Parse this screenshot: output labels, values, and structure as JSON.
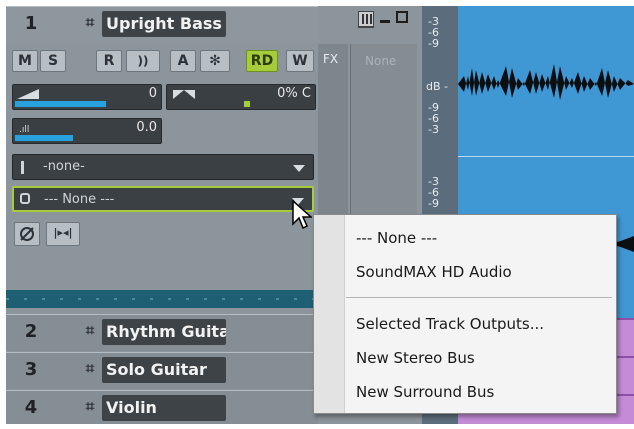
{
  "tracks": [
    {
      "number": "1",
      "name": "Upright Bass"
    },
    {
      "number": "2",
      "name": "Rhythm Guitar"
    },
    {
      "number": "3",
      "name": "Solo Guitar"
    },
    {
      "number": "4",
      "name": "Violin"
    }
  ],
  "track1": {
    "buttons": {
      "mute": "M",
      "solo": "S",
      "record": "R",
      "echo": "))",
      "automation": "A",
      "freeze": "✻",
      "read": "RD",
      "write": "W"
    },
    "volume": {
      "value": "0",
      "level": 0.62
    },
    "pan": {
      "value": "0% C",
      "level": 0.55
    },
    "gain": {
      "value": "0.0",
      "level": 0.4
    },
    "input": {
      "value": "-none-"
    },
    "output": {
      "value": "--- None ---"
    },
    "fx_label": "FX",
    "fx_slot": "None"
  },
  "ruler": {
    "labels_top": [
      "-3",
      "-6",
      "-9"
    ],
    "db_label": "dB -",
    "labels_mid": [
      "-9",
      "-6",
      "-3"
    ],
    "labels_low": [
      "-3",
      "-6",
      "-9"
    ]
  },
  "menu": {
    "items_top": [
      "--- None ---",
      "SoundMAX HD Audio"
    ],
    "items_bottom": [
      "Selected Track Outputs...",
      "New Stereo Bus",
      "New Surround Bus"
    ]
  },
  "colors": {
    "panel": "#8c959c",
    "accent_green": "#a6cc3c",
    "meter_blue": "#28a2de",
    "waveform_bg": "#3f97d4"
  }
}
